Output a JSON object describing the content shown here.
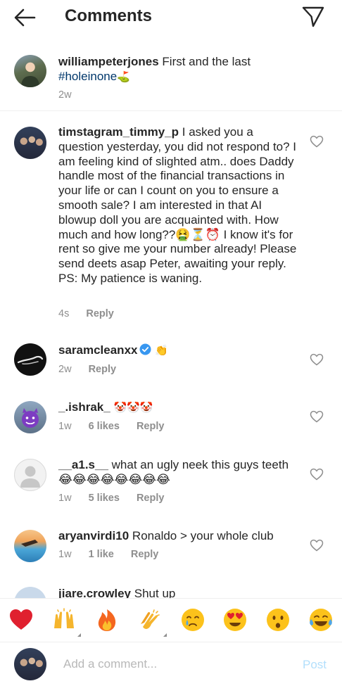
{
  "header": {
    "title": "Comments",
    "back_icon": "arrow-left-icon",
    "send_icon": "paper-plane-icon"
  },
  "caption": {
    "username": "williampeterjones",
    "text": "First and the last",
    "hashtag": "#holeinone",
    "hashtag_emoji": "⛳",
    "time": "2w"
  },
  "comments": [
    {
      "username": "timstagram_timmy_p",
      "text": "I asked you a question yesterday, you did not respond to? I am feeling kind of slighted atm.. does Daddy handle most of the financial transactions in your life or can I count on you to ensure a smooth sale? I am interested in that AI blowup doll you are acquainted with. How much and how long??🤮⏳⏰ I know it's for rent so give me your number already! Please send deets asap Peter, awaiting your reply. PS: My patience is waning.",
      "time": "4s",
      "likes": "",
      "reply": "Reply"
    },
    {
      "username": "saramcleanxx",
      "verified": true,
      "text": "👏",
      "time": "2w",
      "likes": "",
      "reply": "Reply"
    },
    {
      "username": "_.ishrak_",
      "text": "🤡🤡🤡",
      "time": "1w",
      "likes": "6 likes",
      "reply": "Reply"
    },
    {
      "username": "__a1.s__",
      "text": "what an ugly neek this guys teeth 😂😂😂😂😂😂😂😂",
      "time": "1w",
      "likes": "5 likes",
      "reply": "Reply"
    },
    {
      "username": "aryanvirdi10",
      "text": "Ronaldo > your whole club",
      "time": "1w",
      "likes": "1 like",
      "reply": "Reply"
    },
    {
      "username": "jiare.crowley",
      "text": "Shut up",
      "time": "",
      "likes": "",
      "reply": ""
    }
  ],
  "emoji_bar": [
    "heart-emoji",
    "raising-hands-emoji",
    "fire-emoji",
    "clapping-hands-emoji",
    "crying-face-emoji",
    "heart-eyes-emoji",
    "surprised-face-emoji",
    "tears-of-joy-emoji"
  ],
  "composer": {
    "placeholder": "Add a comment...",
    "post_label": "Post"
  },
  "colors": {
    "text": "#262626",
    "muted": "#8e8e8e",
    "hashtag": "#00376b",
    "verified": "#3897f0",
    "post_disabled": "#b2dffc"
  }
}
